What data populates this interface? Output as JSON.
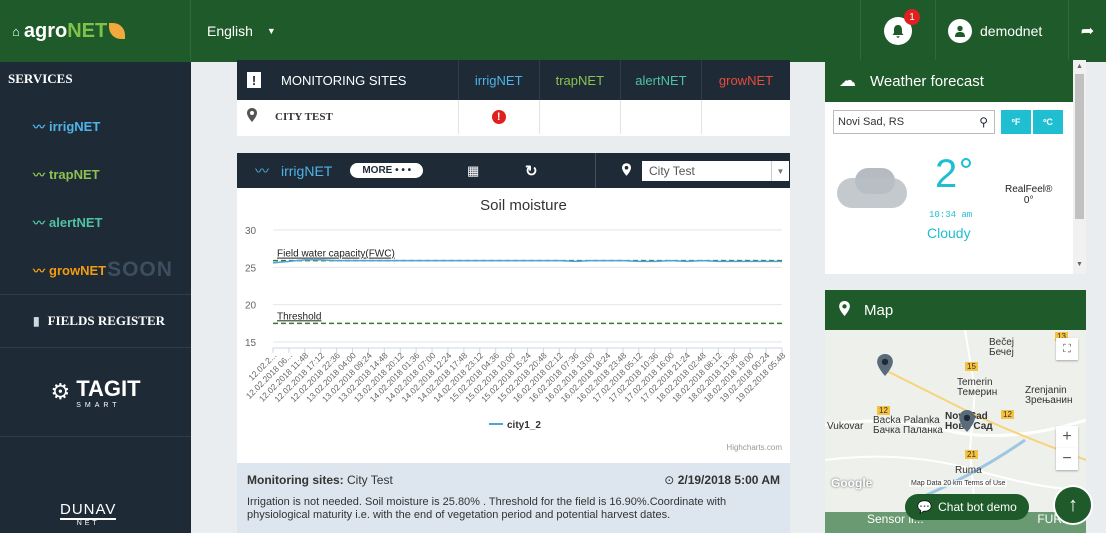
{
  "topbar": {
    "logo_home": "⌂",
    "logo_agro": "agro",
    "logo_net": "NET",
    "language": "English",
    "notif_count": "1",
    "username": "demodnet"
  },
  "sidebar": {
    "title": "SERVICES",
    "items": [
      {
        "label": "irrigNET",
        "color": "#4fb3e8"
      },
      {
        "label": "trapNET",
        "color": "#8cc152"
      },
      {
        "label": "alertNET",
        "color": "#4fc3a1"
      },
      {
        "label": "growNET",
        "color": "#f39c12",
        "soon": "SOON"
      }
    ],
    "fields_register": "FIELDS REGISTER",
    "tagit": "TAGIT",
    "tagit_sub": "SMART",
    "dunav": "DUNAV",
    "dunav_sub": "NET"
  },
  "monitoring": {
    "title": "MONITORING SITES",
    "columns": [
      "irrigNET",
      "trapNET",
      "alertNET",
      "growNET"
    ],
    "column_colors": [
      "#4fb3e8",
      "#8cc152",
      "#4fc3a1",
      "#e74c3c"
    ],
    "row": {
      "site": "CITY TEST",
      "alert": "!"
    }
  },
  "chart_panel": {
    "service": "irrigNET",
    "more_label": "MORE • • •",
    "location_select": "City Test",
    "footer_label": "Monitoring sites:",
    "footer_site": "City Test",
    "footer_date": "2/19/2018 5:00 AM",
    "footer_text": "Irrigation is not needed. Soil moisture is 25.80% . Threshold for the field is 16.90%.Coordinate with physiological maturity i.e. with the end of vegetation period and potential harvest dates.",
    "credits": "Highcharts.com"
  },
  "chart_data": {
    "type": "line",
    "title": "Soil moisture",
    "ylim": [
      15,
      30
    ],
    "yticks": [
      15,
      20,
      25,
      30
    ],
    "x": [
      "12.02.2...",
      "12.02.2018 06...",
      "12.02.2018 11:48",
      "12.02.2018 17:12",
      "12.02.2018 22:36",
      "13.02.2018 04:00",
      "13.02.2018 09:24",
      "13.02.2018 14:48",
      "13.02.2018 20:12",
      "14.02.2018 01:36",
      "14.02.2018 07:00",
      "14.02.2018 12:24",
      "14.02.2018 17:48",
      "14.02.2018 23:12",
      "15.02.2018 04:36",
      "15.02.2018 10:00",
      "15.02.2018 15:24",
      "15.02.2018 20:48",
      "16.02.2018 02:12",
      "16.02.2018 07:36",
      "16.02.2018 13:00",
      "16.02.2018 18:24",
      "16.02.2018 23:48",
      "17.02.2018 05:12",
      "17.02.2018 10:36",
      "17.02.2018 16:00",
      "17.02.2018 21:24",
      "18.02.2018 02:48",
      "18.02.2018 08:12",
      "18.02.2018 13:36",
      "18.02.2018 19:00",
      "19.02.2018 00:24",
      "19.02.2018 05:48"
    ],
    "series": [
      {
        "name": "city1_2",
        "color": "#4fa3d9",
        "values": [
          25.6,
          25.8,
          26.0,
          26.0,
          25.9,
          25.9,
          25.9,
          25.9,
          25.9,
          25.9,
          25.9,
          25.9,
          25.9,
          25.9,
          25.9,
          25.9,
          25.9,
          25.9,
          25.9,
          25.8,
          25.9,
          25.9,
          25.9,
          25.8,
          25.8,
          25.9,
          25.8,
          25.9,
          25.8,
          25.8,
          25.8,
          25.8,
          25.8
        ]
      }
    ],
    "reference_lines": [
      {
        "label": "Field water capacity(FWC)",
        "value": 25.9,
        "color": "#2e7d32"
      },
      {
        "label": "Threshold",
        "value": 17.5,
        "color": "#2e7d32"
      }
    ],
    "legend": "bottom-center"
  },
  "weather": {
    "title": "Weather forecast",
    "search_value": "Novi Sad, RS",
    "btn_f": "ºF",
    "btn_c": "ºC",
    "temperature": "2",
    "time": "10:34 am",
    "condition": "Cloudy",
    "realfeel_label": "RealFeel®",
    "realfeel_value": "0°"
  },
  "map": {
    "title": "Map",
    "cities": [
      {
        "name": "Bečej\nБечеј"
      },
      {
        "name": "Temerin\nТемерин"
      },
      {
        "name": "Zrenjanin\nЗрењанин"
      },
      {
        "name": "Backa Palanka\nБачка Паланка"
      },
      {
        "name": "Novi Sad\nНови Сад"
      },
      {
        "name": "Vukovar"
      },
      {
        "name": "Ruma"
      }
    ],
    "attribution": "Map Data",
    "scale": "20 km",
    "terms": "Terms of Use",
    "google": "Google"
  },
  "chatbot": {
    "label": "Chat bot demo"
  },
  "bottom_strip": {
    "label": "Sensor li...",
    "right": "FUR..."
  }
}
